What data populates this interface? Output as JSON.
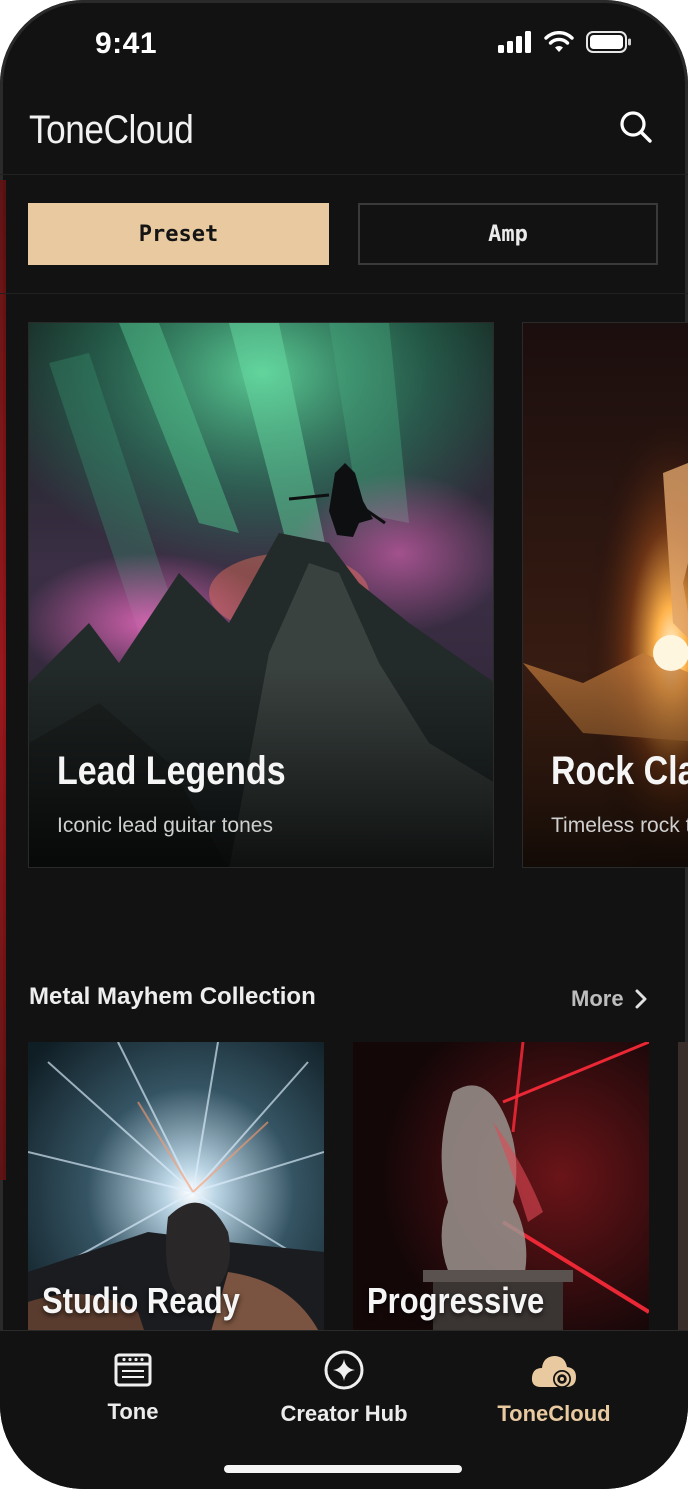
{
  "status_bar": {
    "time": "9:41"
  },
  "header": {
    "title": "ToneCloud"
  },
  "segments": {
    "preset_label": "Preset",
    "amp_label": "Amp"
  },
  "featured": [
    {
      "title": "Lead Legends",
      "subtitle": "Iconic lead guitar tones"
    },
    {
      "title": "Rock Classics",
      "subtitle": "Timeless rock tones"
    }
  ],
  "section": {
    "title": "Metal Mayhem Collection",
    "more_label": "More"
  },
  "collection": [
    {
      "title": "Studio Ready"
    },
    {
      "title": "Progressive"
    }
  ],
  "tabbar": {
    "tone_label": "Tone",
    "creator_hub_label": "Creator Hub",
    "tonecloud_label": "ToneCloud"
  },
  "colors": {
    "background": "#121212",
    "accent": "#e8c9a0",
    "text": "#f1f1f1"
  }
}
